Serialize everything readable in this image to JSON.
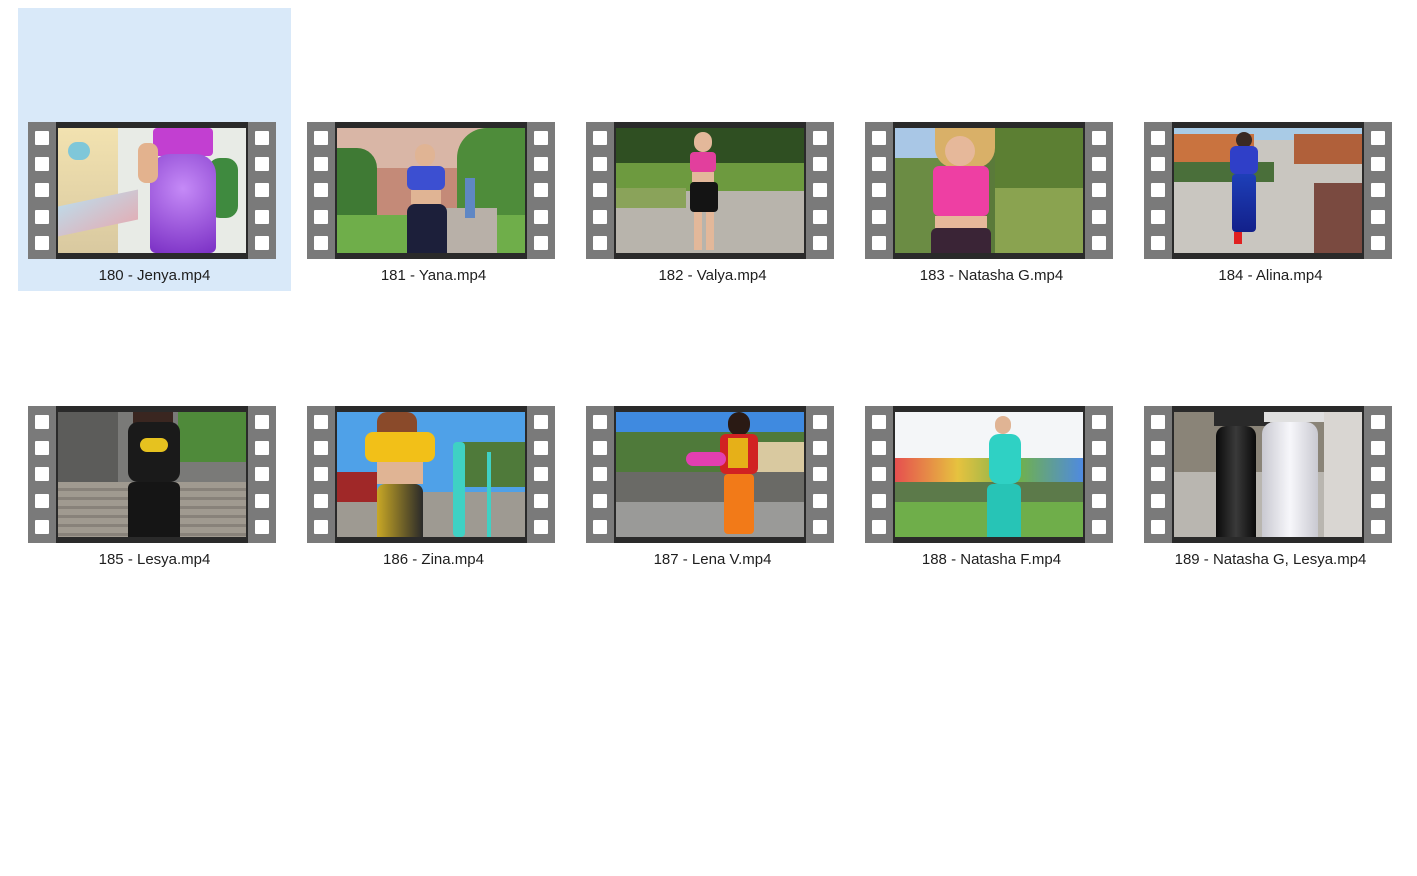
{
  "files": [
    {
      "name": "180 - Jenya.mp4",
      "selected": true
    },
    {
      "name": "181 - Yana.mp4",
      "selected": false
    },
    {
      "name": "182 - Valya.mp4",
      "selected": false
    },
    {
      "name": "183 - Natasha G.mp4",
      "selected": false
    },
    {
      "name": "184 - Alina.mp4",
      "selected": false
    },
    {
      "name": "185 - Lesya.mp4",
      "selected": false
    },
    {
      "name": "186 - Zina.mp4",
      "selected": false
    },
    {
      "name": "187 - Lena V.mp4",
      "selected": false
    },
    {
      "name": "188 - Natasha F.mp4",
      "selected": false
    },
    {
      "name": "189 - Natasha G, Lesya.mp4",
      "selected": false
    }
  ],
  "colors": {
    "selection_bg": "#d9e9f9",
    "filmstrip": "#7a7a7a"
  },
  "icons": {
    "thumbnail": "video-filmstrip-icon"
  }
}
